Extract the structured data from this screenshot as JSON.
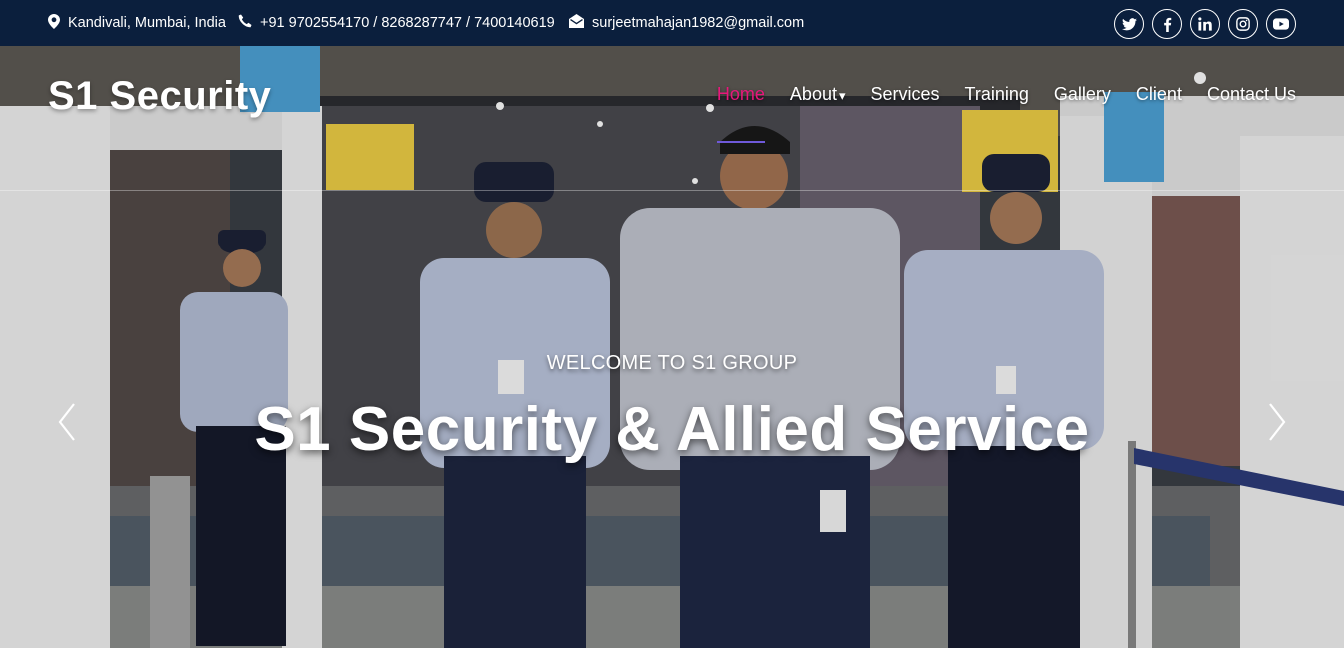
{
  "topbar": {
    "location": "Kandivali, Mumbai, India",
    "phone": "+91 9702554170 / 8268287747 / 7400140619",
    "email": "surjeetmahajan1982@gmail.com",
    "socials": [
      "twitter-icon",
      "facebook-icon",
      "linkedin-icon",
      "instagram-icon",
      "youtube-icon"
    ]
  },
  "brand": "S1 Security",
  "nav": {
    "items": [
      {
        "label": "Home",
        "active": true
      },
      {
        "label": "About"
      },
      {
        "label": "Services"
      },
      {
        "label": "Training"
      },
      {
        "label": "Gallery"
      },
      {
        "label": "Client"
      },
      {
        "label": "Contact Us"
      }
    ],
    "about_caret": "▾"
  },
  "hero": {
    "kicker": "WELCOME TO S1 GROUP",
    "headline": "S1 Security & Allied Service"
  },
  "colors": {
    "topbar_bg": "#0b1f3d",
    "active_link": "#e8177c",
    "active_underline": "#6f59d9"
  }
}
